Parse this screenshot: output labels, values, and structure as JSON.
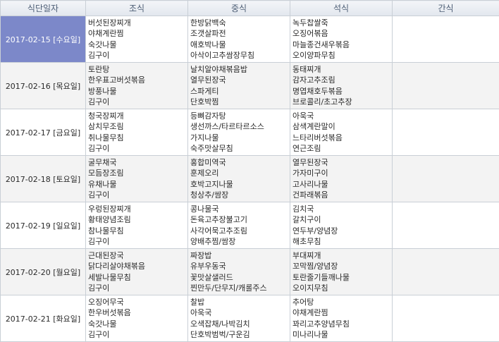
{
  "headers": [
    "식단일자",
    "조식",
    "중식",
    "석식",
    "간식"
  ],
  "selected_row": 0,
  "rows": [
    {
      "date": "2017-02-15 [수요일]",
      "breakfast": [
        "버섯된장찌개",
        "야채계란찜",
        "숙갓나물",
        "김구이"
      ],
      "lunch": [
        "한방닭백숙",
        "조갯살파전",
        "애호박나물",
        "아삭이고추쌈장무침"
      ],
      "dinner": [
        "녹두찹쌀죽",
        "오징어볶음",
        "마늘종건새우볶음",
        "오이양파무침"
      ],
      "snack": []
    },
    {
      "date": "2017-02-16 [목요일]",
      "breakfast": [
        "토란탕",
        "한우표고버섯볶음",
        "방풍나물",
        "김구이"
      ],
      "lunch": [
        "날치알야채볶음밥",
        "열무된장국",
        "스파게티",
        "단호박찜"
      ],
      "dinner": [
        "동태찌개",
        "감자고추조림",
        "명엽채호두볶음",
        "브로콜리/초고추장"
      ],
      "snack": []
    },
    {
      "date": "2017-02-17 [금요일]",
      "breakfast": [
        "청국장찌개",
        "삼치무조림",
        "취나물무침",
        "김구이"
      ],
      "lunch": [
        "등뼈감자탕",
        "생선까스/타르타르소스",
        "가지나물",
        "숙주맛살무침"
      ],
      "dinner": [
        "아욱국",
        "삼색계란말이",
        "느타리버섯볶음",
        "연근조림"
      ],
      "snack": []
    },
    {
      "date": "2017-02-18 [토요일]",
      "breakfast": [
        "굴무채국",
        "모듬장조림",
        "유채나물",
        "김구이"
      ],
      "lunch": [
        "홍합미역국",
        "훈제오리",
        "호박고지나물",
        "청상추/쌈장"
      ],
      "dinner": [
        "열무된장국",
        "가자미구이",
        "고사리나물",
        "건파래볶음"
      ],
      "snack": []
    },
    {
      "date": "2017-02-19 [일요일]",
      "breakfast": [
        "우렁된장찌개",
        "황태양념조림",
        "참나물무침",
        "김구이"
      ],
      "lunch": [
        "콩나물국",
        "돈육고추장불고기",
        "사각어묵고추조림",
        "양배추찜/쌈장"
      ],
      "dinner": [
        "김치국",
        "갈치구이",
        "연두부/양념장",
        "해초무침"
      ],
      "snack": []
    },
    {
      "date": "2017-02-20 [월요일]",
      "breakfast": [
        "근대된장국",
        "닭다리살야채볶음",
        "세발나물무침",
        "김구이"
      ],
      "lunch": [
        "짜장밥",
        "유부우동국",
        "꽃맛살샐러드",
        "찐만두/단무지/캐롤주스"
      ],
      "dinner": [
        "부대찌개",
        "꼬막찜/양념장",
        "토란줄기들깨나물",
        "오이지무침"
      ],
      "snack": []
    },
    {
      "date": "2017-02-21 [화요일]",
      "breakfast": [
        "오징어무국",
        "한우버섯볶음",
        "숙갓나물",
        "김구이"
      ],
      "lunch": [
        "찰밥",
        "아욱국",
        "오색잡채/나박김치",
        "단호박범벅/구운김"
      ],
      "dinner": [
        "추어탕",
        "야채계란찜",
        "꽈리고추양념무침",
        "미나리나물"
      ],
      "snack": []
    }
  ]
}
